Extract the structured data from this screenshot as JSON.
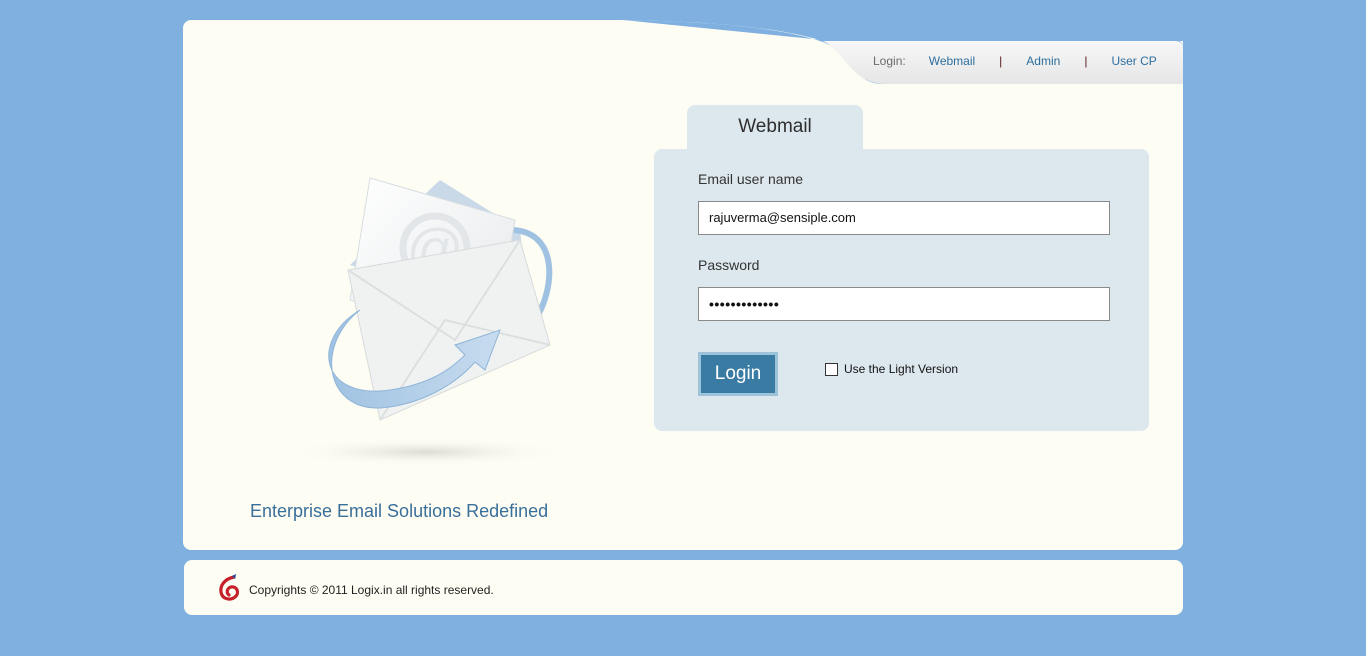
{
  "nav": {
    "login_label": "Login:",
    "webmail": "Webmail",
    "separator": "|",
    "admin": "Admin",
    "usercp": "User CP"
  },
  "illustration": {
    "icon": "email-envelope-icon"
  },
  "tagline": "Enterprise Email Solutions Redefined",
  "login_panel": {
    "tab_title": "Webmail",
    "username_label": "Email user name",
    "username_value": "rajuverma@sensiple.com",
    "password_label": "Password",
    "password_value": "•••••••••••••",
    "login_button": "Login",
    "light_version_label": "Use the Light Version",
    "light_version_checked": false
  },
  "footer": {
    "logo_icon": "logix-logo-icon",
    "copyright": "Copyrights © 2011 Logix.in all rights reserved."
  },
  "colors": {
    "background": "#7fb0e0",
    "card": "#fdfdf3",
    "panel": "#dde8ee",
    "button": "#3a7ba4",
    "link": "#2d6e9e",
    "tagline": "#3a6f9a"
  }
}
